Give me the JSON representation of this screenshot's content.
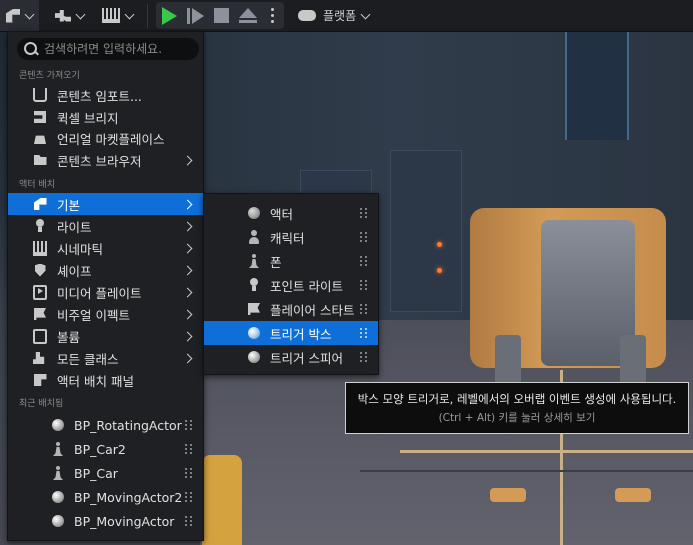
{
  "toolbar": {
    "platforms_label": "플랫폼"
  },
  "search": {
    "placeholder": "검색하려면 입력하세요."
  },
  "sections": {
    "content_import": "콘텐츠 가져오기",
    "actor_placement": "액터 배치",
    "recently_placed": "최근 배치됨"
  },
  "content_items": [
    {
      "label": "콘텐츠 임포트...",
      "icon": "import-icon",
      "has_submenu": false
    },
    {
      "label": "퀵셀 브리지",
      "icon": "bridge-icon",
      "has_submenu": false
    },
    {
      "label": "언리얼 마켓플레이스",
      "icon": "marketplace-icon",
      "has_submenu": false
    },
    {
      "label": "콘텐츠 브라우저",
      "icon": "folder-icon",
      "has_submenu": true
    }
  ],
  "actor_items": [
    {
      "label": "기본",
      "icon": "basic-shapes-icon",
      "selected": true
    },
    {
      "label": "라이트",
      "icon": "light-bulb-icon"
    },
    {
      "label": "시네마틱",
      "icon": "film-icon"
    },
    {
      "label": "셰이프",
      "icon": "shield-icon"
    },
    {
      "label": "미디어 플레이트",
      "icon": "media-icon"
    },
    {
      "label": "비주얼 이펙트",
      "icon": "flag-icon"
    },
    {
      "label": "볼륨",
      "icon": "square-icon"
    },
    {
      "label": "모든 클래스",
      "icon": "people-icon"
    },
    {
      "label": "액터 배치 패널",
      "icon": "panel-icon"
    }
  ],
  "recent_items": [
    {
      "label": "BP_RotatingActor",
      "icon": "sphere-icon"
    },
    {
      "label": "BP_Car2",
      "icon": "pawn-icon"
    },
    {
      "label": "BP_Car",
      "icon": "pawn-icon"
    },
    {
      "label": "BP_MovingActor2",
      "icon": "sphere-icon"
    },
    {
      "label": "BP_MovingActor",
      "icon": "sphere-icon"
    }
  ],
  "basic_submenu": [
    {
      "label": "액터",
      "icon": "circle-icon"
    },
    {
      "label": "캐릭터",
      "icon": "person-icon"
    },
    {
      "label": "폰",
      "icon": "pawn-icon"
    },
    {
      "label": "포인트 라이트",
      "icon": "light-bulb-icon"
    },
    {
      "label": "플레이어 스타트",
      "icon": "flag-icon"
    },
    {
      "label": "트리거 박스",
      "icon": "sphere-icon",
      "selected": true
    },
    {
      "label": "트리거 스피어",
      "icon": "sphere-icon"
    }
  ],
  "tooltip": {
    "main": "박스 모양 트리거로, 레벨에서의 오버랩 이벤트 생성에 사용됩니다.",
    "hint": "(Ctrl + Alt) 키를 눌러 상세히 보기"
  },
  "colors": {
    "accent": "#0f6fd8",
    "play_green": "#38c94a"
  }
}
